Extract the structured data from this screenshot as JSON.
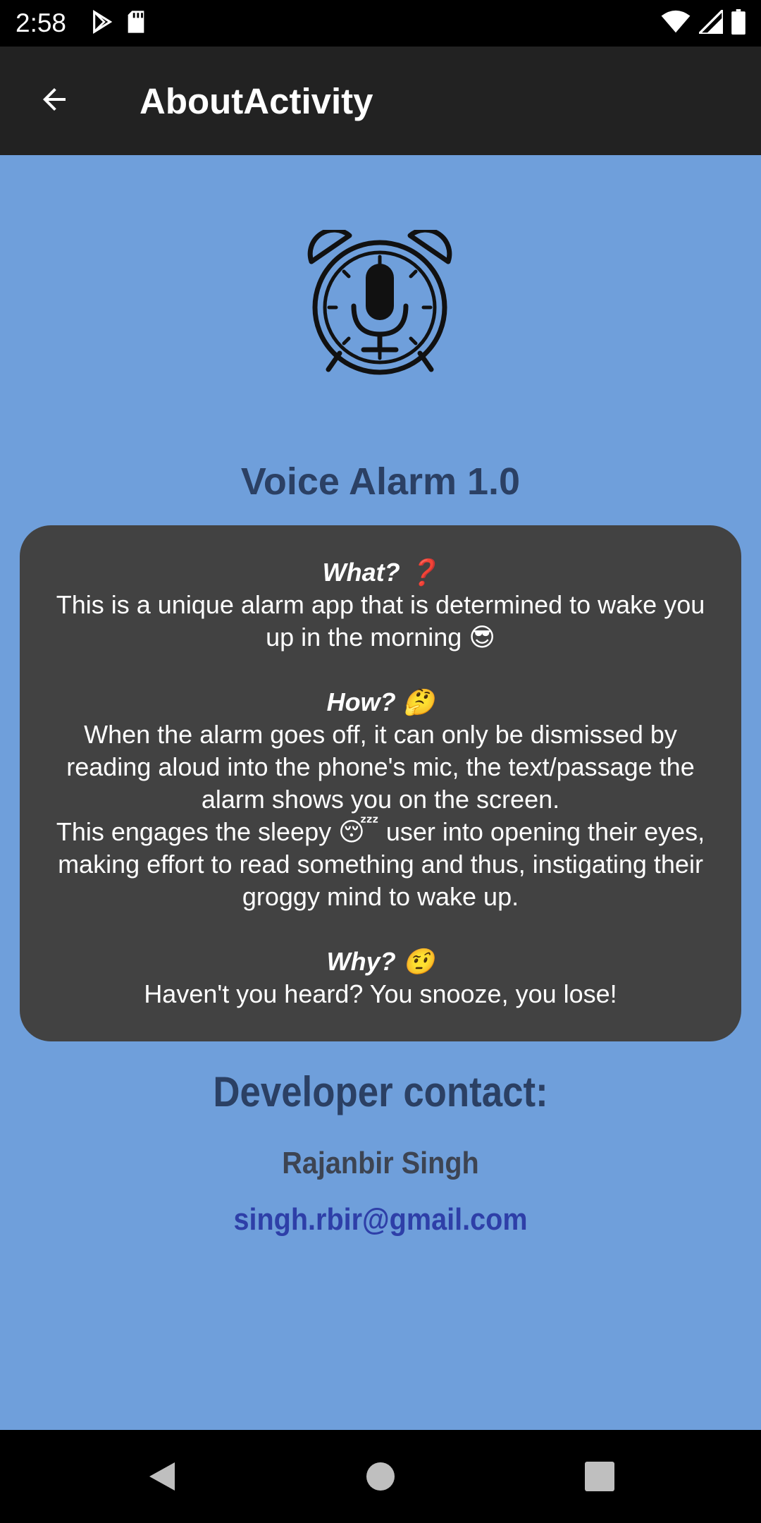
{
  "status_bar": {
    "time": "2:58",
    "icons": [
      "play-store-icon",
      "sd-card-icon",
      "wifi-icon",
      "signal-icon",
      "battery-icon"
    ]
  },
  "app_bar": {
    "title": "AboutActivity",
    "back_icon": "arrow-back-icon"
  },
  "logo_icon": "alarm-clock-microphone-icon",
  "app_name": "Voice Alarm 1.0",
  "card": {
    "what_q": "What? ❓",
    "what_text": "This is a unique alarm app that is determined to wake you up in the morning 😎",
    "how_q": "How? 🤔",
    "how_text1": "When the alarm goes off, it can only be dismissed by reading aloud into the phone's mic, the text/passage the alarm shows you on the screen.",
    "how_text2": "This engages the sleepy 😴 user into opening their eyes, making effort to read something and thus, instigating their groggy mind to wake up.",
    "why_q": "Why? 🤨",
    "why_text": "Haven't you heard? You snooze, you lose!"
  },
  "developer": {
    "heading": "Developer contact:",
    "name": "Rajanbir Singh",
    "email": "singh.rbir@gmail.com"
  },
  "colors": {
    "background": "#6f9fdb",
    "app_bar": "#222222",
    "card": "#424242",
    "heading": "#2b4064",
    "email": "#2e3fa8"
  },
  "nav_bar": {
    "icons": [
      "back-triangle-icon",
      "home-circle-icon",
      "recents-square-icon"
    ]
  }
}
